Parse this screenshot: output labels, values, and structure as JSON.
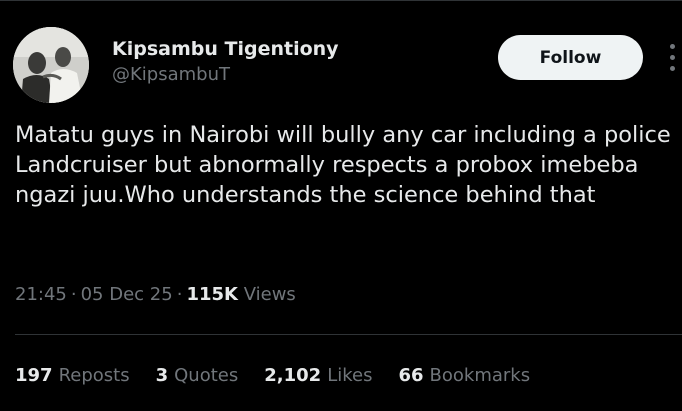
{
  "author": {
    "display_name": "Kipsambu Tigentiony",
    "handle": "@KipsambuT",
    "avatar_icon": "profile-photo"
  },
  "actions": {
    "follow_label": "Follow",
    "more_icon": "more-vertical-icon"
  },
  "tweet": {
    "text": "Matatu guys in Nairobi will bully any car including a police Landcruiser but abnormally respects a probox imebeba ngazi juu.Who understands the science behind that",
    "time": "21:45",
    "date": "05 Dec 25",
    "views_count": "115K",
    "views_label": "Views"
  },
  "stats": [
    {
      "count": "197",
      "label": "Reposts"
    },
    {
      "count": "3",
      "label": "Quotes"
    },
    {
      "count": "2,102",
      "label": "Likes"
    },
    {
      "count": "66",
      "label": "Bookmarks"
    }
  ],
  "colors": {
    "background": "#000000",
    "primary_text": "#e7e9ea",
    "secondary_text": "#71767b",
    "divider": "#2f3336",
    "follow_bg": "#eff3f4"
  }
}
